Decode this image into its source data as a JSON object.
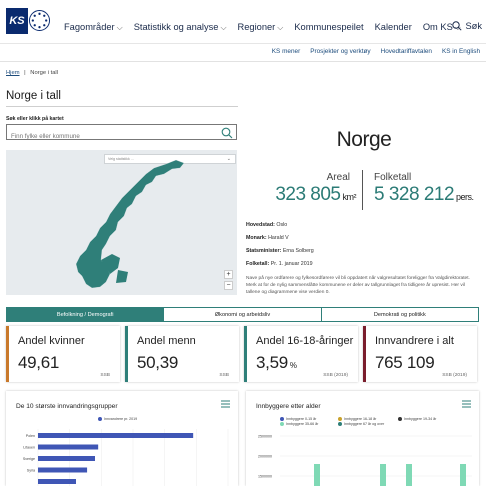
{
  "header": {
    "nav": [
      {
        "label": "Fagområder",
        "dropdown": true
      },
      {
        "label": "Statistikk og analyse",
        "dropdown": true
      },
      {
        "label": "Regioner",
        "dropdown": true
      },
      {
        "label": "Kommunespeilet",
        "dropdown": false
      },
      {
        "label": "Kalender",
        "dropdown": false
      },
      {
        "label": "Om KS",
        "dropdown": true
      }
    ],
    "search_label": "Søk",
    "sublinks": [
      "KS mener",
      "Prosjekter og verktøy",
      "Hovedtariffavtalen",
      "KS in English"
    ]
  },
  "breadcrumb": {
    "home": "Hjem",
    "separator": "|",
    "current": "Norge i tall"
  },
  "page_title": "Norge i tall",
  "search": {
    "label": "Søk eller klikk på kartet",
    "placeholder": "Finn fylke eller kommune"
  },
  "map": {
    "select_label": "Velg statistikk ..."
  },
  "norge": {
    "title": "Norge",
    "area": {
      "label": "Areal",
      "value": "323 805",
      "unit": "km²"
    },
    "population": {
      "label": "Folketall",
      "value": "5 328 212",
      "unit": "pers."
    },
    "facts": [
      {
        "label": "Hovedstad:",
        "value": "Oslo"
      },
      {
        "label": "Monark:",
        "value": "Harald V"
      },
      {
        "label": "Statsminister:",
        "value": "Erna Solberg"
      },
      {
        "label": "Folketall:",
        "value": "Pr. 1. januar 2019"
      }
    ],
    "note": "Nave på nye ordførere og fylkesordførere vil bli oppdatert når valgresultatet foreligger fra Valgdirektoratet. Merk at for de nylig sammenslåtte kommunene er deler av tallgrunnlaget fra tidligere år upresist. Her vil tallene og diagrammene vise verdien 0."
  },
  "tabs": [
    {
      "label": "Befolkning / Demografi",
      "active": true
    },
    {
      "label": "Økonomi og arbeidsliv",
      "active": false
    },
    {
      "label": "Demokrati og politikk",
      "active": false
    }
  ],
  "cards": [
    {
      "title": "Andel kvinner",
      "value": "49,61",
      "unit": "",
      "source": "SSB",
      "color": "#c9792b"
    },
    {
      "title": "Andel menn",
      "value": "50,39",
      "unit": "",
      "source": "SSB",
      "color": "#2f7f79"
    },
    {
      "title": "Andel 16-18-åringer",
      "value": "3,59",
      "unit": "%",
      "source": "SSB (2019)",
      "color": "#2f7f79"
    },
    {
      "title": "Innvandrere i alt",
      "value": "765 109",
      "unit": "",
      "source": "SSB (2019)",
      "color": "#7a1d2c"
    }
  ],
  "chart_data": [
    {
      "type": "bar",
      "title": "De 10 største innvandringsgrupper",
      "series": [
        {
          "name": "Innvandrere pr. 2019",
          "color": "#3f56b5"
        }
      ],
      "categories": [
        "Polen",
        "Litauen",
        "Sverige",
        "Syria",
        ""
      ],
      "values": [
        98000,
        38000,
        36000,
        31000,
        24000
      ],
      "xlim": [
        0,
        120000
      ]
    },
    {
      "type": "bar",
      "title": "Innbyggere etter alder",
      "legend": [
        {
          "name": "Innbyggere 0-15 år",
          "color": "#3f56b5"
        },
        {
          "name": "Innbyggere 16-18 år",
          "color": "#c9a22b"
        },
        {
          "name": "Innbyggere 19-34 år",
          "color": "#333333"
        },
        {
          "name": "Innbyggere 35-66 år",
          "color": "#7fd9b5"
        },
        {
          "name": "Innbyggere 67 år og over",
          "color": "#2f7f79"
        }
      ],
      "y_ticks": [
        "2500000",
        "2000000",
        "1500000"
      ],
      "visible_values": [
        1800000,
        1800000,
        1800000,
        1800000
      ]
    }
  ]
}
